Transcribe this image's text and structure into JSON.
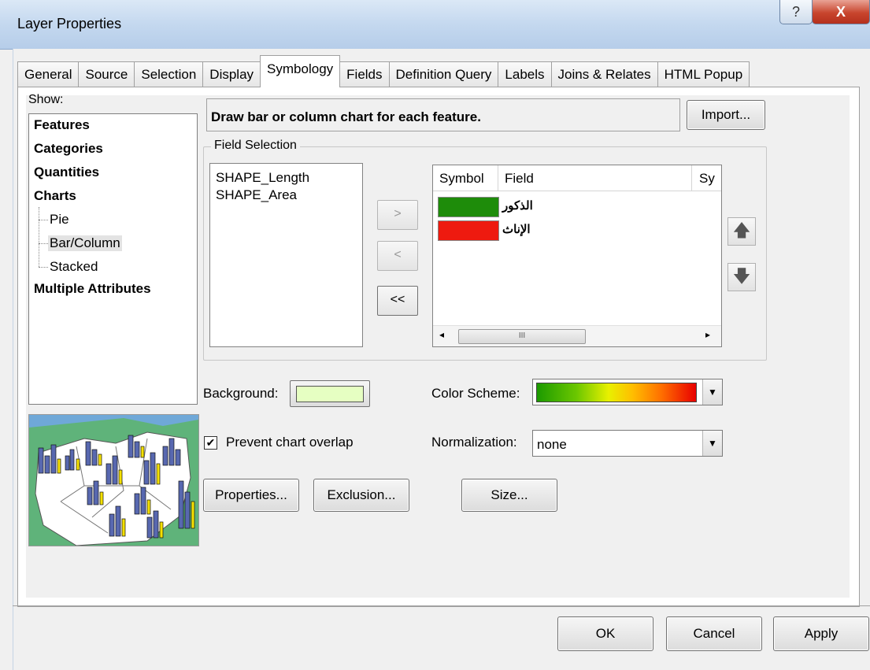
{
  "window": {
    "title": "Layer Properties",
    "help_glyph": "?",
    "close_glyph": "X"
  },
  "tabs": [
    {
      "label": "General"
    },
    {
      "label": "Source"
    },
    {
      "label": "Selection"
    },
    {
      "label": "Display"
    },
    {
      "label": "Symbology"
    },
    {
      "label": "Fields"
    },
    {
      "label": "Definition Query"
    },
    {
      "label": "Labels"
    },
    {
      "label": "Joins & Relates"
    },
    {
      "label": "HTML Popup"
    }
  ],
  "active_tab": "Symbology",
  "show": {
    "label": "Show:",
    "items": [
      "Features",
      "Categories",
      "Quantities",
      "Charts"
    ],
    "chart_subitems": [
      "Pie",
      "Bar/Column",
      "Stacked"
    ],
    "selected_subitem": "Bar/Column",
    "last_item": "Multiple Attributes"
  },
  "description": "Draw bar or column chart for each feature.",
  "import_label": "Import...",
  "field_selection": {
    "label": "Field Selection",
    "available_fields": [
      "SHAPE_Length",
      "SHAPE_Area"
    ],
    "move_right": ">",
    "move_left": "<",
    "move_all_left": "<<",
    "columns": [
      "Symbol",
      "Field",
      "Sy"
    ],
    "selected_fields": [
      {
        "label": "الذكور",
        "color": "#1e8c0a"
      },
      {
        "label": "الإناث",
        "color": "#ee1a0f"
      }
    ],
    "scroll_thumb": "III",
    "scroll_left": "◂",
    "scroll_right": "▸",
    "up_glyph": "🡅",
    "down_glyph": "🡇"
  },
  "background": {
    "label": "Background:",
    "color": "#e6ffc2"
  },
  "color_scheme": {
    "label": "Color  Scheme:"
  },
  "prevent_overlap": {
    "label": "Prevent chart overlap",
    "checked": true,
    "check_glyph": "✔"
  },
  "normalization": {
    "label": "Normalization:",
    "value": "none"
  },
  "buttons": {
    "properties": "Properties...",
    "exclusion": "Exclusion...",
    "size": "Size...",
    "ok": "OK",
    "cancel": "Cancel",
    "apply": "Apply"
  },
  "combo_arrow": "▼"
}
